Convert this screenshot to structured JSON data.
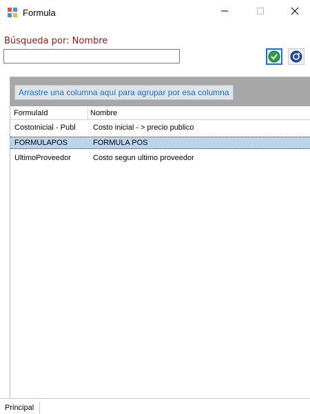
{
  "window": {
    "title": "Formula"
  },
  "icons": {
    "app": "form-window-icon",
    "minimize": "minimize-icon",
    "maximize": "maximize-icon",
    "close": "close-icon",
    "ok": "check-circle-icon",
    "refresh": "refresh-circle-icon"
  },
  "search": {
    "label": "Búsqueda por: Nombre",
    "value": "",
    "placeholder": ""
  },
  "grid": {
    "group_hint": "Arrastre una columna aquí para agrupar por esa columna",
    "columns": [
      "FormulaId",
      "Nombre"
    ],
    "rows": [
      {
        "id": "CostoInicial - Publ",
        "name": "Costo inicial - > precio publico",
        "selected": false
      },
      {
        "id": "FORMULAPOS",
        "name": "FORMULA POS",
        "selected": true
      },
      {
        "id": "UltimoProveedor",
        "name": "Costo segun ultimo proveedor",
        "selected": false
      }
    ]
  },
  "tabs": {
    "principal": "Principal"
  },
  "colors": {
    "accent": "#1f6fd1",
    "label": "#8b1a1a",
    "selection": "#bcd3ec",
    "group_bg": "#a7a7a7"
  }
}
